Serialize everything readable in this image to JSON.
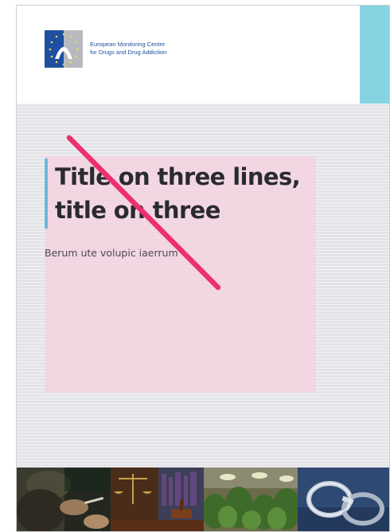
{
  "header": {
    "org_name_line1": "European Monitoring Centre",
    "org_name_line2": "for Drugs and Drug Addiction",
    "logo_icon": "emcdda-logo-icon",
    "accent_color": "#86d3e2"
  },
  "cover": {
    "title_line1": "Title on three lines,",
    "title_line2": "title on three",
    "subtitle": "Berum ute volupic iaerrum",
    "highlight_color": "#f6d2e0",
    "slash_color": "#ec2f6e"
  },
  "photos": [
    {
      "subject": "smoking-hands-photo"
    },
    {
      "subject": "court-gavel-scales-photo"
    },
    {
      "subject": "cannabis-plants-photo"
    },
    {
      "subject": "handcuffs-photo"
    }
  ]
}
